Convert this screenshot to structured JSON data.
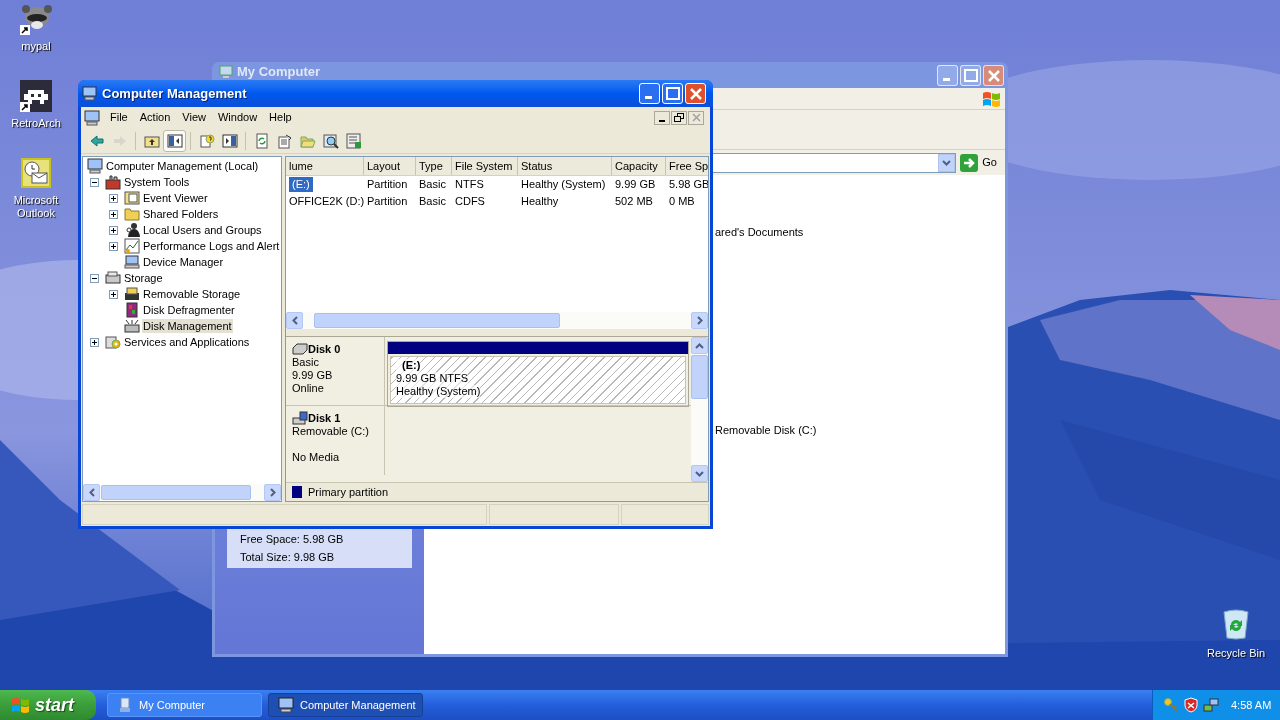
{
  "desktop_icons": [
    {
      "kind": "raccoon",
      "label": "mypal",
      "shortcut": true
    },
    {
      "kind": "invader",
      "label": "RetroArch",
      "shortcut": true
    },
    {
      "kind": "outlook",
      "label": "Microsoft Outlook",
      "shortcut": false
    }
  ],
  "recycle_bin": {
    "label": "Recycle Bin"
  },
  "my_computer": {
    "title": "My Computer",
    "go_button": "Go",
    "items": [
      "ared's Documents",
      "Removable Disk (C:)"
    ],
    "details": [
      "Free Space: 5.98 GB",
      "Total Size: 9.98 GB"
    ]
  },
  "computer_management": {
    "title": "Computer Management",
    "menu": [
      "File",
      "Action",
      "View",
      "Window",
      "Help"
    ],
    "toolbar": [
      {
        "buttons": [
          {
            "kind": "back",
            "disabled": false,
            "pressed": false
          },
          {
            "kind": "forward",
            "disabled": true,
            "pressed": false
          }
        ]
      },
      {
        "buttons": [
          {
            "kind": "up",
            "disabled": false,
            "pressed": false
          },
          {
            "kind": "tree",
            "disabled": false,
            "pressed": true
          }
        ]
      },
      {
        "buttons": [
          {
            "kind": "help",
            "disabled": false,
            "pressed": false
          },
          {
            "kind": "panel",
            "disabled": false,
            "pressed": false
          }
        ]
      },
      {
        "buttons": [
          {
            "kind": "refresh",
            "disabled": false,
            "pressed": false
          },
          {
            "kind": "properties",
            "disabled": false,
            "pressed": false
          },
          {
            "kind": "open",
            "disabled": false,
            "pressed": false
          },
          {
            "kind": "find",
            "disabled": false,
            "pressed": false
          },
          {
            "kind": "export",
            "disabled": false,
            "pressed": false
          }
        ]
      }
    ],
    "tree": [
      {
        "label": "Computer Management (Local)",
        "kind": "computer",
        "selected": false,
        "children": [
          {
            "label": "System Tools",
            "kind": "tools",
            "expanded": true,
            "selected": false,
            "children": [
              {
                "label": "Event Viewer",
                "kind": "event",
                "expanded": false,
                "selected": false
              },
              {
                "label": "Shared Folders",
                "kind": "folder",
                "expanded": false,
                "selected": false
              },
              {
                "label": "Local Users and Groups",
                "kind": "users",
                "expanded": false,
                "selected": false
              },
              {
                "label": "Performance Logs and Alert",
                "kind": "perf",
                "expanded": false,
                "selected": false
              },
              {
                "label": "Device Manager",
                "kind": "device",
                "selected": false
              }
            ]
          },
          {
            "label": "Storage",
            "kind": "storage",
            "expanded": true,
            "selected": false,
            "children": [
              {
                "label": "Removable Storage",
                "kind": "removable",
                "expanded": false,
                "selected": false
              },
              {
                "label": "Disk Defragmenter",
                "kind": "defrag",
                "selected": false
              },
              {
                "label": "Disk Management",
                "kind": "diskmgmt",
                "selected": true
              }
            ]
          },
          {
            "label": "Services and Applications",
            "kind": "services",
            "expanded": false,
            "selected": false
          }
        ]
      }
    ],
    "volumes": {
      "columns": [
        "lume",
        "Layout",
        "Type",
        "File System",
        "Status",
        "Capacity",
        "Free Sp"
      ],
      "rows": [
        {
          "selected": true,
          "cells": [
            "(E:)",
            "Partition",
            "Basic",
            "NTFS",
            "Healthy (System)",
            "9.99 GB",
            "5.98 GB"
          ]
        },
        {
          "selected": false,
          "cells": [
            "OFFICE2K (D:)",
            "Partition",
            "Basic",
            "CDFS",
            "Healthy",
            "502 MB",
            "0 MB"
          ]
        }
      ]
    },
    "disks": [
      {
        "kind": "fixed",
        "name": "Disk 0",
        "type": "Basic",
        "capacity": "9.99 GB",
        "status": "Online",
        "partition": {
          "label": "(E:)",
          "size": "9.99 GB NTFS",
          "status": "Healthy (System)"
        }
      },
      {
        "kind": "removable",
        "name": "Disk 1",
        "type": "Removable (C:)",
        "status": "No Media"
      }
    ],
    "legend": [
      {
        "label": "Primary partition",
        "color": "#000080"
      }
    ]
  },
  "taskbar": {
    "start": "start",
    "tasks": [
      {
        "label": "My Computer",
        "kind": "folder",
        "selected": false
      },
      {
        "label": "Computer Management",
        "kind": "computer",
        "selected": true
      }
    ],
    "clock": "4:58 AM"
  }
}
